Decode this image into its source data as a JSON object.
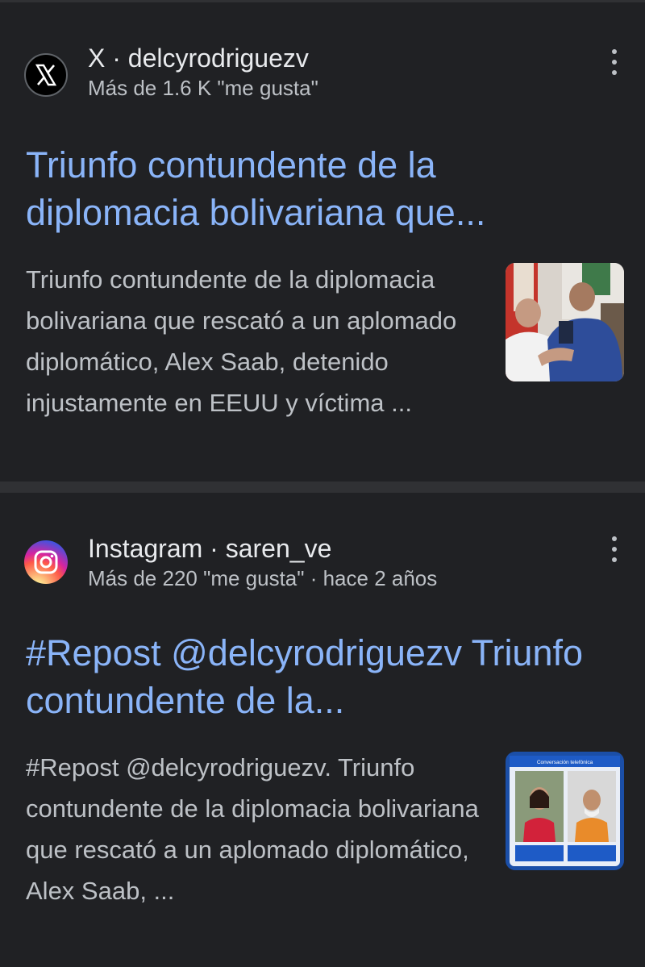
{
  "results": [
    {
      "source_name": "X · delcyrodriguezv",
      "meta": "Más de 1.6 K \"me gusta\"",
      "title": "Triunfo contundente de la diplomacia bolivariana que...",
      "snippet": "Triunfo contundente de la diplomacia bolivariana que rescató a un aplomado diplomático, Alex Saab, detenido injustamente en EEUU y víctima ...",
      "icon": "x-logo-icon"
    },
    {
      "source_name": "Instagram · saren_ve",
      "meta": "Más de 220 \"me gusta\" · hace 2 años",
      "title": "#Repost @delcyrodriguezv Triunfo contundente de la...",
      "snippet": "#Repost @delcyrodriguezv. Triunfo contundente de la diplomacia bolivariana que rescató a un aplomado diplomático, Alex Saab, ...",
      "icon": "instagram-logo-icon",
      "thumb_text": "Conversación telefónica"
    }
  ],
  "colors": {
    "background": "#202124",
    "divider": "#303134",
    "link": "#8ab4f8",
    "text": "#e8eaed",
    "muted": "#bdc1c6"
  }
}
